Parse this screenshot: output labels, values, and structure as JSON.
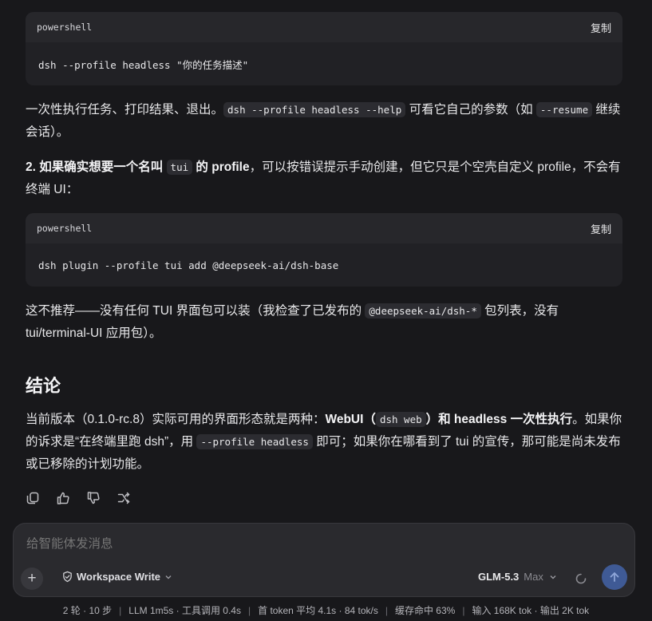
{
  "code_blocks": [
    {
      "lang": "powershell",
      "copy_label": "复制",
      "code": "dsh --profile headless \"你的任务描述\""
    },
    {
      "lang": "powershell",
      "copy_label": "复制",
      "code": "dsh plugin --profile tui add @deepseek-ai/dsh-base"
    }
  ],
  "p1": {
    "t1": "一次性执行任务、打印结果、退出。",
    "c1": "dsh --profile headless --help",
    "t2": " 可看它自己的参数（如 ",
    "c2": "--resume",
    "t3": " 继续会话）。"
  },
  "p2": {
    "b1": "2. 如果确实想要一个名叫 ",
    "c1": "tui",
    "b2": " 的 profile",
    "t1": "，可以按错误提示手动创建，但它只是个空壳自定义 profile，不会有终端 UI："
  },
  "p3": {
    "t1": "这不推荐——没有任何 TUI 界面包可以装（我检查了已发布的 ",
    "c1": "@deepseek-ai/dsh-*",
    "t2": " 包列表，没有 tui/terminal-UI 应用包）。"
  },
  "heading": "结论",
  "p4": {
    "t1": "当前版本（0.1.0-rc.8）实际可用的界面形态就是两种：",
    "b1": "WebUI（",
    "c1": "dsh web",
    "b2": "）和 headless 一次性执行",
    "t2": "。如果你的诉求是“在终端里跑 dsh”，用 ",
    "c2": "--profile headless",
    "t3": " 即可；如果你在哪看到了 tui 的宣传，那可能是尚未发布或已移除的计划功能。"
  },
  "actions": [
    "copy-icon",
    "thumbs-up-icon",
    "thumbs-down-icon",
    "retry-icon"
  ],
  "composer": {
    "placeholder": "给智能体发消息",
    "mode_label": "Workspace Write",
    "model_name": "GLM-5.3",
    "model_tier": "Max"
  },
  "status": {
    "turns": "2 轮 · 10 步",
    "llm": "LLM 1m5s · 工具调用 0.4s",
    "ttft": "首 token 平均 4.1s · 84 tok/s",
    "cache": "缓存命中 63%",
    "tokens": "输入 168K tok · 输出 2K tok"
  },
  "colors": {
    "background": "#18181b",
    "code_bg": "#212125",
    "send_button": "#3f5a95"
  }
}
